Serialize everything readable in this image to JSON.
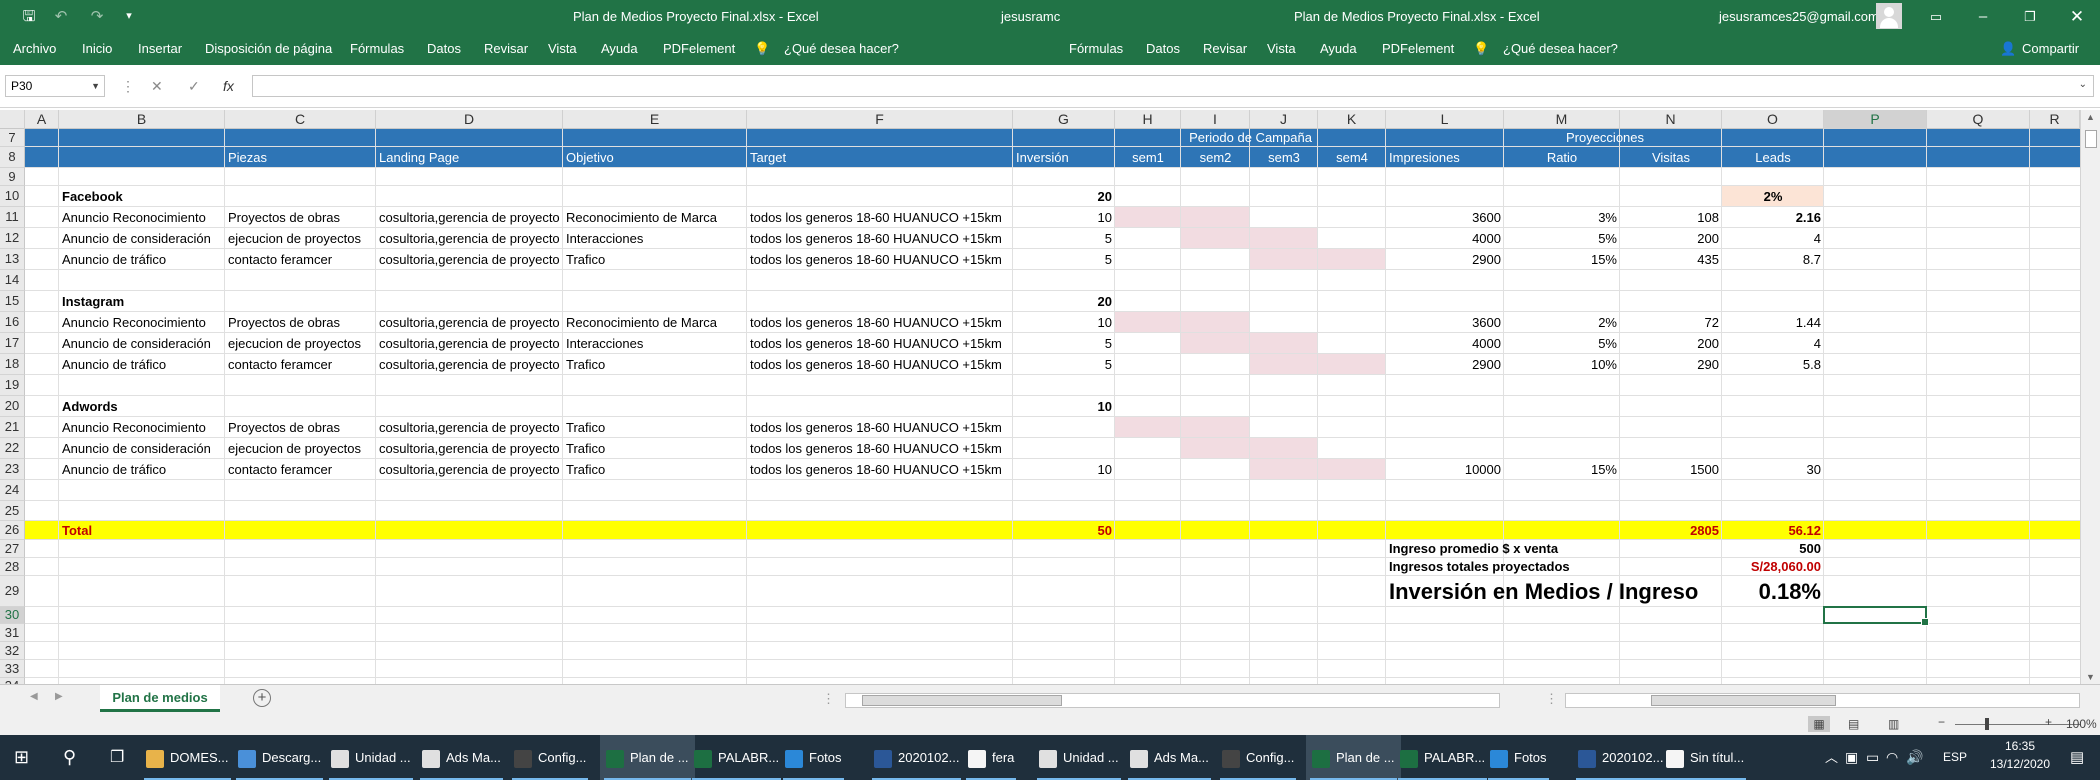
{
  "titlebar": {
    "left_title": "Plan de Medios Proyecto Final.xlsx  -  Excel",
    "user_left": "jesusramc",
    "right_title": "Plan de Medios Proyecto Final.xlsx  -  Excel",
    "user_right": "jesusramces25@gmail.com"
  },
  "ribbon": {
    "left": [
      "Archivo",
      "Inicio",
      "Insertar",
      "Disposición de página",
      "Fórmulas",
      "Datos",
      "Revisar",
      "Vista",
      "Ayuda",
      "PDFelement",
      "¿Qué desea hacer?"
    ],
    "right": [
      "Fórmulas",
      "Datos",
      "Revisar",
      "Vista",
      "Ayuda",
      "PDFelement",
      "¿Qué desea hacer?"
    ],
    "share": "Compartir"
  },
  "formula": {
    "name_box": "P30",
    "fx": "fx",
    "value": ""
  },
  "columns": [
    "A",
    "B",
    "C",
    "D",
    "E",
    "F",
    "G",
    "H",
    "I",
    "J",
    "K",
    "L",
    "M",
    "N",
    "O",
    "P",
    "Q",
    "R"
  ],
  "rows": [
    "7",
    "8",
    "9",
    "10",
    "11",
    "12",
    "13",
    "14",
    "15",
    "16",
    "17",
    "18",
    "19",
    "20",
    "21",
    "22",
    "23",
    "24",
    "25",
    "26",
    "27",
    "28",
    "29",
    "30",
    "31",
    "32",
    "33",
    "34"
  ],
  "sheet": {
    "group_headers": {
      "periodo": "Periodo de Campaña",
      "proyecciones": "Proyecciones"
    },
    "headers": {
      "piezas": "Piezas",
      "landing": "Landing Page",
      "objetivo": "Objetivo",
      "target": "Target",
      "inversion": "Inversión",
      "sem1": "sem1",
      "sem2": "sem2",
      "sem3": "sem3",
      "sem4": "sem4",
      "impresiones": "Impresiones",
      "ratio": "Ratio",
      "visitas": "Visitas",
      "leads": "Leads"
    },
    "sections": [
      {
        "name": "Facebook",
        "inversion": "20",
        "leads_rate": "2%",
        "rows": [
          {
            "anuncio": "Anuncio Reconocimiento",
            "pieza": "Proyectos de obras",
            "landing": "cosultoria,gerencia de proyecto",
            "objetivo": "Reconocimiento de Marca",
            "target": "todos los generos 18-60 HUANUCO +15km",
            "inversion": "10",
            "impresiones": "3600",
            "ratio": "3%",
            "visitas": "108",
            "leads": "2.16"
          },
          {
            "anuncio": "Anuncio de consideración",
            "pieza": "ejecucion de proyectos",
            "landing": "cosultoria,gerencia de proyecto",
            "objetivo": "Interacciones",
            "target": "todos los generos 18-60 HUANUCO +15km",
            "inversion": "5",
            "impresiones": "4000",
            "ratio": "5%",
            "visitas": "200",
            "leads": "4"
          },
          {
            "anuncio": "Anuncio de tráfico",
            "pieza": "contacto feramcer",
            "landing": "cosultoria,gerencia de proyecto",
            "objetivo": "Trafico",
            "target": "todos los generos 18-60 HUANUCO +15km",
            "inversion": "5",
            "impresiones": "2900",
            "ratio": "15%",
            "visitas": "435",
            "leads": "8.7"
          }
        ]
      },
      {
        "name": "Instagram",
        "inversion": "20",
        "rows": [
          {
            "anuncio": "Anuncio Reconocimiento",
            "pieza": "Proyectos de obras",
            "landing": "cosultoria,gerencia de proyecto",
            "objetivo": "Reconocimiento de Marca",
            "target": "todos los generos 18-60 HUANUCO +15km",
            "inversion": "10",
            "impresiones": "3600",
            "ratio": "2%",
            "visitas": "72",
            "leads": "1.44"
          },
          {
            "anuncio": "Anuncio de consideración",
            "pieza": "ejecucion de proyectos",
            "landing": "cosultoria,gerencia de proyecto",
            "objetivo": "Interacciones",
            "target": "todos los generos 18-60 HUANUCO +15km",
            "inversion": "5",
            "impresiones": "4000",
            "ratio": "5%",
            "visitas": "200",
            "leads": "4"
          },
          {
            "anuncio": "Anuncio de tráfico",
            "pieza": "contacto feramcer",
            "landing": "cosultoria,gerencia de proyecto",
            "objetivo": "Trafico",
            "target": "todos los generos 18-60 HUANUCO +15km",
            "inversion": "5",
            "impresiones": "2900",
            "ratio": "10%",
            "visitas": "290",
            "leads": "5.8"
          }
        ]
      },
      {
        "name": "Adwords",
        "inversion": "10",
        "rows": [
          {
            "anuncio": "Anuncio Reconocimiento",
            "pieza": "Proyectos de obras",
            "landing": "cosultoria,gerencia de proyecto",
            "objetivo": "Trafico",
            "target": "todos los generos 18-60 HUANUCO +15km",
            "inversion": "",
            "impresiones": "",
            "ratio": "",
            "visitas": "",
            "leads": ""
          },
          {
            "anuncio": "Anuncio de consideración",
            "pieza": "ejecucion de proyectos",
            "landing": "cosultoria,gerencia de proyecto",
            "objetivo": "Trafico",
            "target": "todos los generos 18-60 HUANUCO +15km",
            "inversion": "",
            "impresiones": "",
            "ratio": "",
            "visitas": "",
            "leads": ""
          },
          {
            "anuncio": "Anuncio de tráfico",
            "pieza": "contacto feramcer",
            "landing": "cosultoria,gerencia de proyecto",
            "objetivo": "Trafico",
            "target": "todos los generos 18-60 HUANUCO +15km",
            "inversion": "10",
            "impresiones": "10000",
            "ratio": "15%",
            "visitas": "1500",
            "leads": "30"
          }
        ]
      }
    ],
    "total": {
      "label": "Total",
      "inversion": "50",
      "visitas": "2805",
      "leads": "56.12"
    },
    "summary": {
      "ingreso_label": "Ingreso promedio $ x venta",
      "ingreso_value": "500",
      "totales_label": "Ingresos totales proyectados",
      "totales_value": "S/28,060.00",
      "ratio_label": "Inversión en Medios / Ingreso",
      "ratio_value": "0.18%"
    }
  },
  "tabs": {
    "active": "Plan de medios"
  },
  "status": {
    "zoom": "100%"
  },
  "taskbar": {
    "items": [
      "DOMES...",
      "Descarg...",
      "Unidad ...",
      "Ads Ma...",
      "Config...",
      "Plan de ...",
      "PALABR...",
      "Fotos",
      "2020102...",
      "fera",
      "Unidad ...",
      "Ads Ma...",
      "Config...",
      "Plan de ...",
      "PALABR...",
      "Fotos",
      "2020102...",
      "Sin títul..."
    ],
    "lang": "ESP",
    "time": "16:35",
    "date": "13/12/2020"
  },
  "colors": {
    "excel_green": "#217346",
    "header_blue": "#2e75b6",
    "total_yellow": "#ffff00",
    "pink": "#f2dce1",
    "red": "#c00000"
  }
}
